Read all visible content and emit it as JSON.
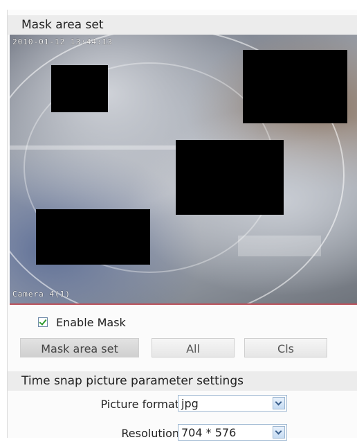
{
  "mask_section": {
    "title": "Mask area set"
  },
  "video": {
    "timestamp_osd": "2010-01-12 13:44:13",
    "camera_osd": "Camera 4(1)"
  },
  "enable_mask": {
    "label": "Enable Mask",
    "checked": true
  },
  "buttons": {
    "mask_area_set": "Mask area set",
    "all": "All",
    "cls": "Cls"
  },
  "snap_section": {
    "title": "Time snap picture parameter settings",
    "picture_format": {
      "label": "Picture format",
      "value": "jpg"
    },
    "resolution": {
      "label": "Resolution",
      "value": "704 * 576"
    }
  },
  "colors": {
    "header_bg": "#ececec",
    "video_border": "#b9505a",
    "checkbox_tick": "#2f9a2f",
    "select_border": "#9db7d1"
  }
}
